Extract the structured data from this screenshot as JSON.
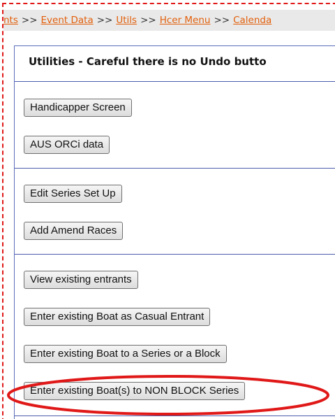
{
  "breadcrumb": {
    "items": [
      "nts",
      "Event Data",
      "Utils",
      "Hcer Menu",
      "Calenda"
    ],
    "separator": ">>"
  },
  "panel": {
    "title": "Utilities - Careful there is no Undo butto"
  },
  "buttons": {
    "handicapper_screen": "Handicapper Screen",
    "aus_orci_data": "AUS ORCi data",
    "edit_series_setup": "Edit Series Set Up",
    "add_amend_races": "Add Amend Races",
    "view_existing_entrants": "View existing entrants",
    "enter_boat_casual": "Enter existing Boat as Casual Entrant",
    "enter_boat_series_block": "Enter existing Boat to a Series or a Block",
    "enter_boats_non_block": "Enter existing Boat(s) to NON BLOCK Series"
  },
  "colors": {
    "frame": "#e01818",
    "link": "#e25f0b",
    "divider": "#4a5cab",
    "highlight": "#e01818"
  }
}
